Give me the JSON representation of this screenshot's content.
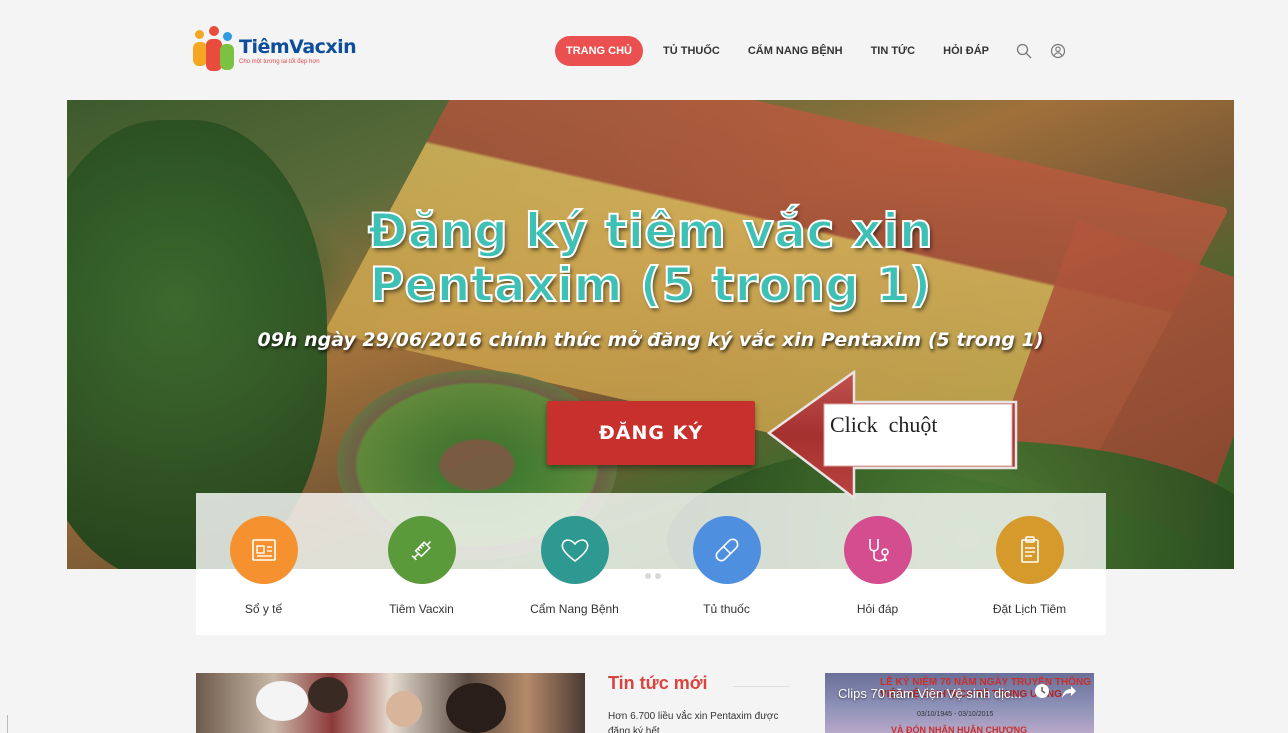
{
  "header": {
    "logo_name": "TiêmVacxin",
    "logo_slogan": "Cho một tương lai tốt đẹp hơn",
    "nav": [
      {
        "label": "TRANG CHỦ",
        "active": true
      },
      {
        "label": "TỦ THUỐC",
        "active": false
      },
      {
        "label": "CẨM NANG BỆNH",
        "active": false
      },
      {
        "label": "TIN TỨC",
        "active": false
      },
      {
        "label": "HỎI ĐÁP",
        "active": false
      }
    ],
    "icons": [
      "search-icon",
      "user-icon"
    ],
    "accent_color": "#e9504f"
  },
  "hero": {
    "title_line1": "Đăng ký tiêm vắc xin",
    "title_line2": "Pentaxim (5 trong 1)",
    "subtitle": "09h ngày 29/06/2016 chính thức mở đăng ký vắc xin Pentaxim (5 trong 1)",
    "button_label": "ĐĂNG KÝ",
    "button_color": "#c8302e",
    "title_color": "#3ec0b4"
  },
  "annotation": {
    "text": "Click  chuột",
    "arrow_color": "#a5312f"
  },
  "features": [
    {
      "label": "Sổ y tế",
      "icon": "id-card-icon",
      "color": "#f5922f"
    },
    {
      "label": "Tiêm Vacxin",
      "icon": "syringe-icon",
      "color": "#5a9a3b"
    },
    {
      "label": "Cẩm Nang Bệnh",
      "icon": "heart-icon",
      "color": "#2e9990"
    },
    {
      "label": "Tủ thuốc",
      "icon": "pill-icon",
      "color": "#4f8fe0"
    },
    {
      "label": "Hỏi đáp",
      "icon": "stethoscope-icon",
      "color": "#d44d8f"
    },
    {
      "label": "Đặt Lịch Tiêm",
      "icon": "clipboard-icon",
      "color": "#d59a2b"
    }
  ],
  "news": {
    "heading": "Tin tức mới",
    "first_item": "Hơn 6.700 liều vắc xin Pentaxim được đăng ký hết"
  },
  "video": {
    "title": "Clips 70 năm Viện Vệ sinh dịc...",
    "bg_line1": "LỄ KỶ NIỆM 70 NĂM NGÀY TRUYỀN THỐNG",
    "bg_line2": "VIỆN VỆ SINH DỊCH TỄ TRUNG ƯƠNG",
    "bg_line3": "03/10/1945 - 03/10/2015",
    "bg_line4": "VÀ ĐÓN NHẬN HUÂN CHƯƠNG",
    "icons": [
      "clock-icon",
      "share-icon"
    ]
  }
}
